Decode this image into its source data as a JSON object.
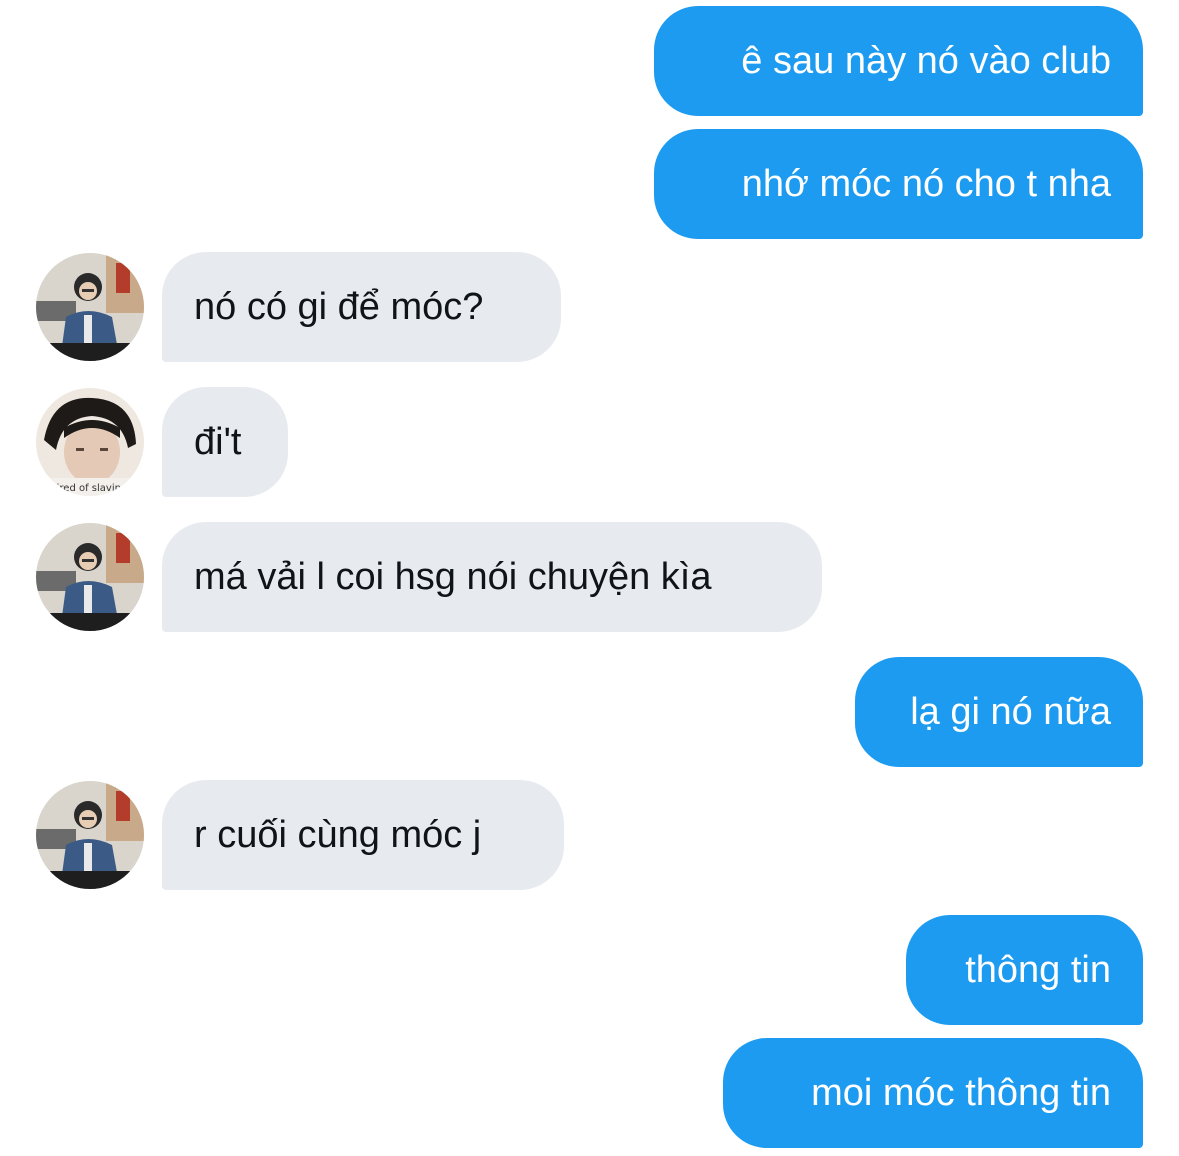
{
  "colors": {
    "outgoing_bubble": "#1d9bf0",
    "incoming_bubble": "#e7ebef",
    "outgoing_text": "#ffffff",
    "incoming_text": "#0f1419"
  },
  "messages": [
    {
      "side": "outgoing",
      "text": "ê sau này nó vào club"
    },
    {
      "side": "outgoing",
      "text": "nhớ móc nó cho t nha"
    },
    {
      "side": "incoming",
      "avatar": "user-a-avatar",
      "text": "nó có gi để móc?"
    },
    {
      "side": "incoming",
      "avatar": "user-b-avatar",
      "text": "đi't"
    },
    {
      "side": "incoming",
      "avatar": "user-a-avatar",
      "text": "má vải l coi hsg nói chuyện kìa"
    },
    {
      "side": "outgoing",
      "text": "lạ gi nó nữa"
    },
    {
      "side": "incoming",
      "avatar": "user-a-avatar",
      "text": "r cuối cùng móc j"
    },
    {
      "side": "outgoing",
      "text": "thông tin"
    },
    {
      "side": "outgoing",
      "text": "moi móc thông tin"
    }
  ],
  "avatars": {
    "user_b_caption": "tired of slaving"
  }
}
